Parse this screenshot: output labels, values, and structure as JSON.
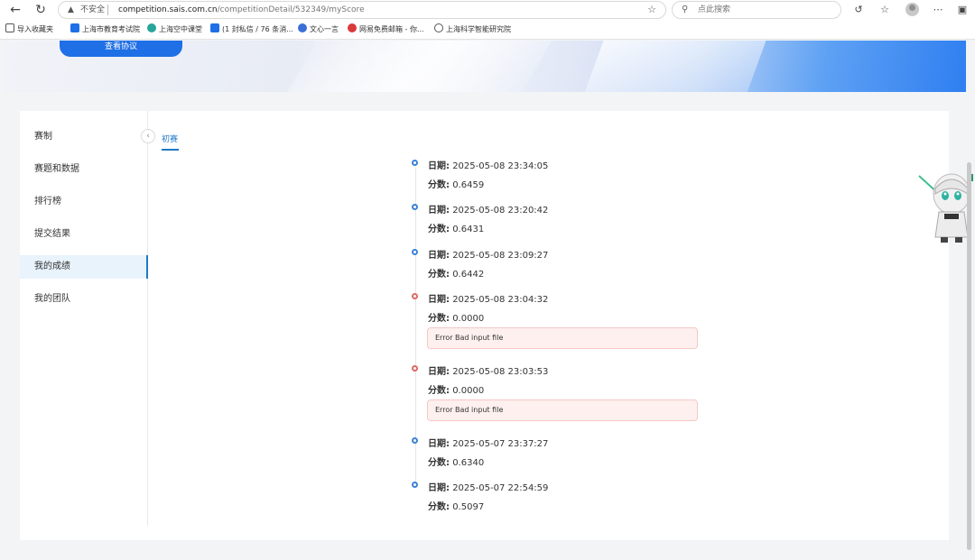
{
  "browser": {
    "security_label": "不安全",
    "url_host": "competition.sais.com.cn",
    "url_path": "/competitionDetail/532349/myScore",
    "search_placeholder": "点此搜索"
  },
  "bookmarks": [
    {
      "label": "导入收藏夹",
      "color": "#555555"
    },
    {
      "label": "上海市教育考试院",
      "color": "#1f6fe6"
    },
    {
      "label": "上海空中课堂",
      "color": "#26a69a"
    },
    {
      "label": "(1 封私信 / 76 条消...",
      "color": "#1f6fe6"
    },
    {
      "label": "文心一言",
      "color": "#3b6fd6"
    },
    {
      "label": "网易免费邮箱 - 你...",
      "color": "#d9393b"
    },
    {
      "label": "上海科学智能研究院",
      "color": "#555555"
    }
  ],
  "banner": {
    "agree_button": "查看协议"
  },
  "sidebar": {
    "items": [
      {
        "label": "赛制",
        "active": false
      },
      {
        "label": "赛题和数据",
        "active": false
      },
      {
        "label": "排行榜",
        "active": false
      },
      {
        "label": "提交结果",
        "active": false
      },
      {
        "label": "我的成绩",
        "active": true
      },
      {
        "label": "我的团队",
        "active": false
      }
    ]
  },
  "tabs": [
    {
      "label": "初赛",
      "active": true
    }
  ],
  "labels": {
    "date": "日期:",
    "score": "分数:"
  },
  "submissions": [
    {
      "date": "2025-05-08 23:34:05",
      "score": "0.6459",
      "status": "ok",
      "error": ""
    },
    {
      "date": "2025-05-08 23:20:42",
      "score": "0.6431",
      "status": "ok",
      "error": ""
    },
    {
      "date": "2025-05-08 23:09:27",
      "score": "0.6442",
      "status": "ok",
      "error": ""
    },
    {
      "date": "2025-05-08 23:04:32",
      "score": "0.0000",
      "status": "error",
      "error": "Error Bad input file"
    },
    {
      "date": "2025-05-08 23:03:53",
      "score": "0.0000",
      "status": "error",
      "error": "Error Bad input file"
    },
    {
      "date": "2025-05-07 23:37:27",
      "score": "0.6340",
      "status": "ok",
      "error": ""
    },
    {
      "date": "2025-05-07 22:54:59",
      "score": "0.5097",
      "status": "ok",
      "error": ""
    }
  ]
}
